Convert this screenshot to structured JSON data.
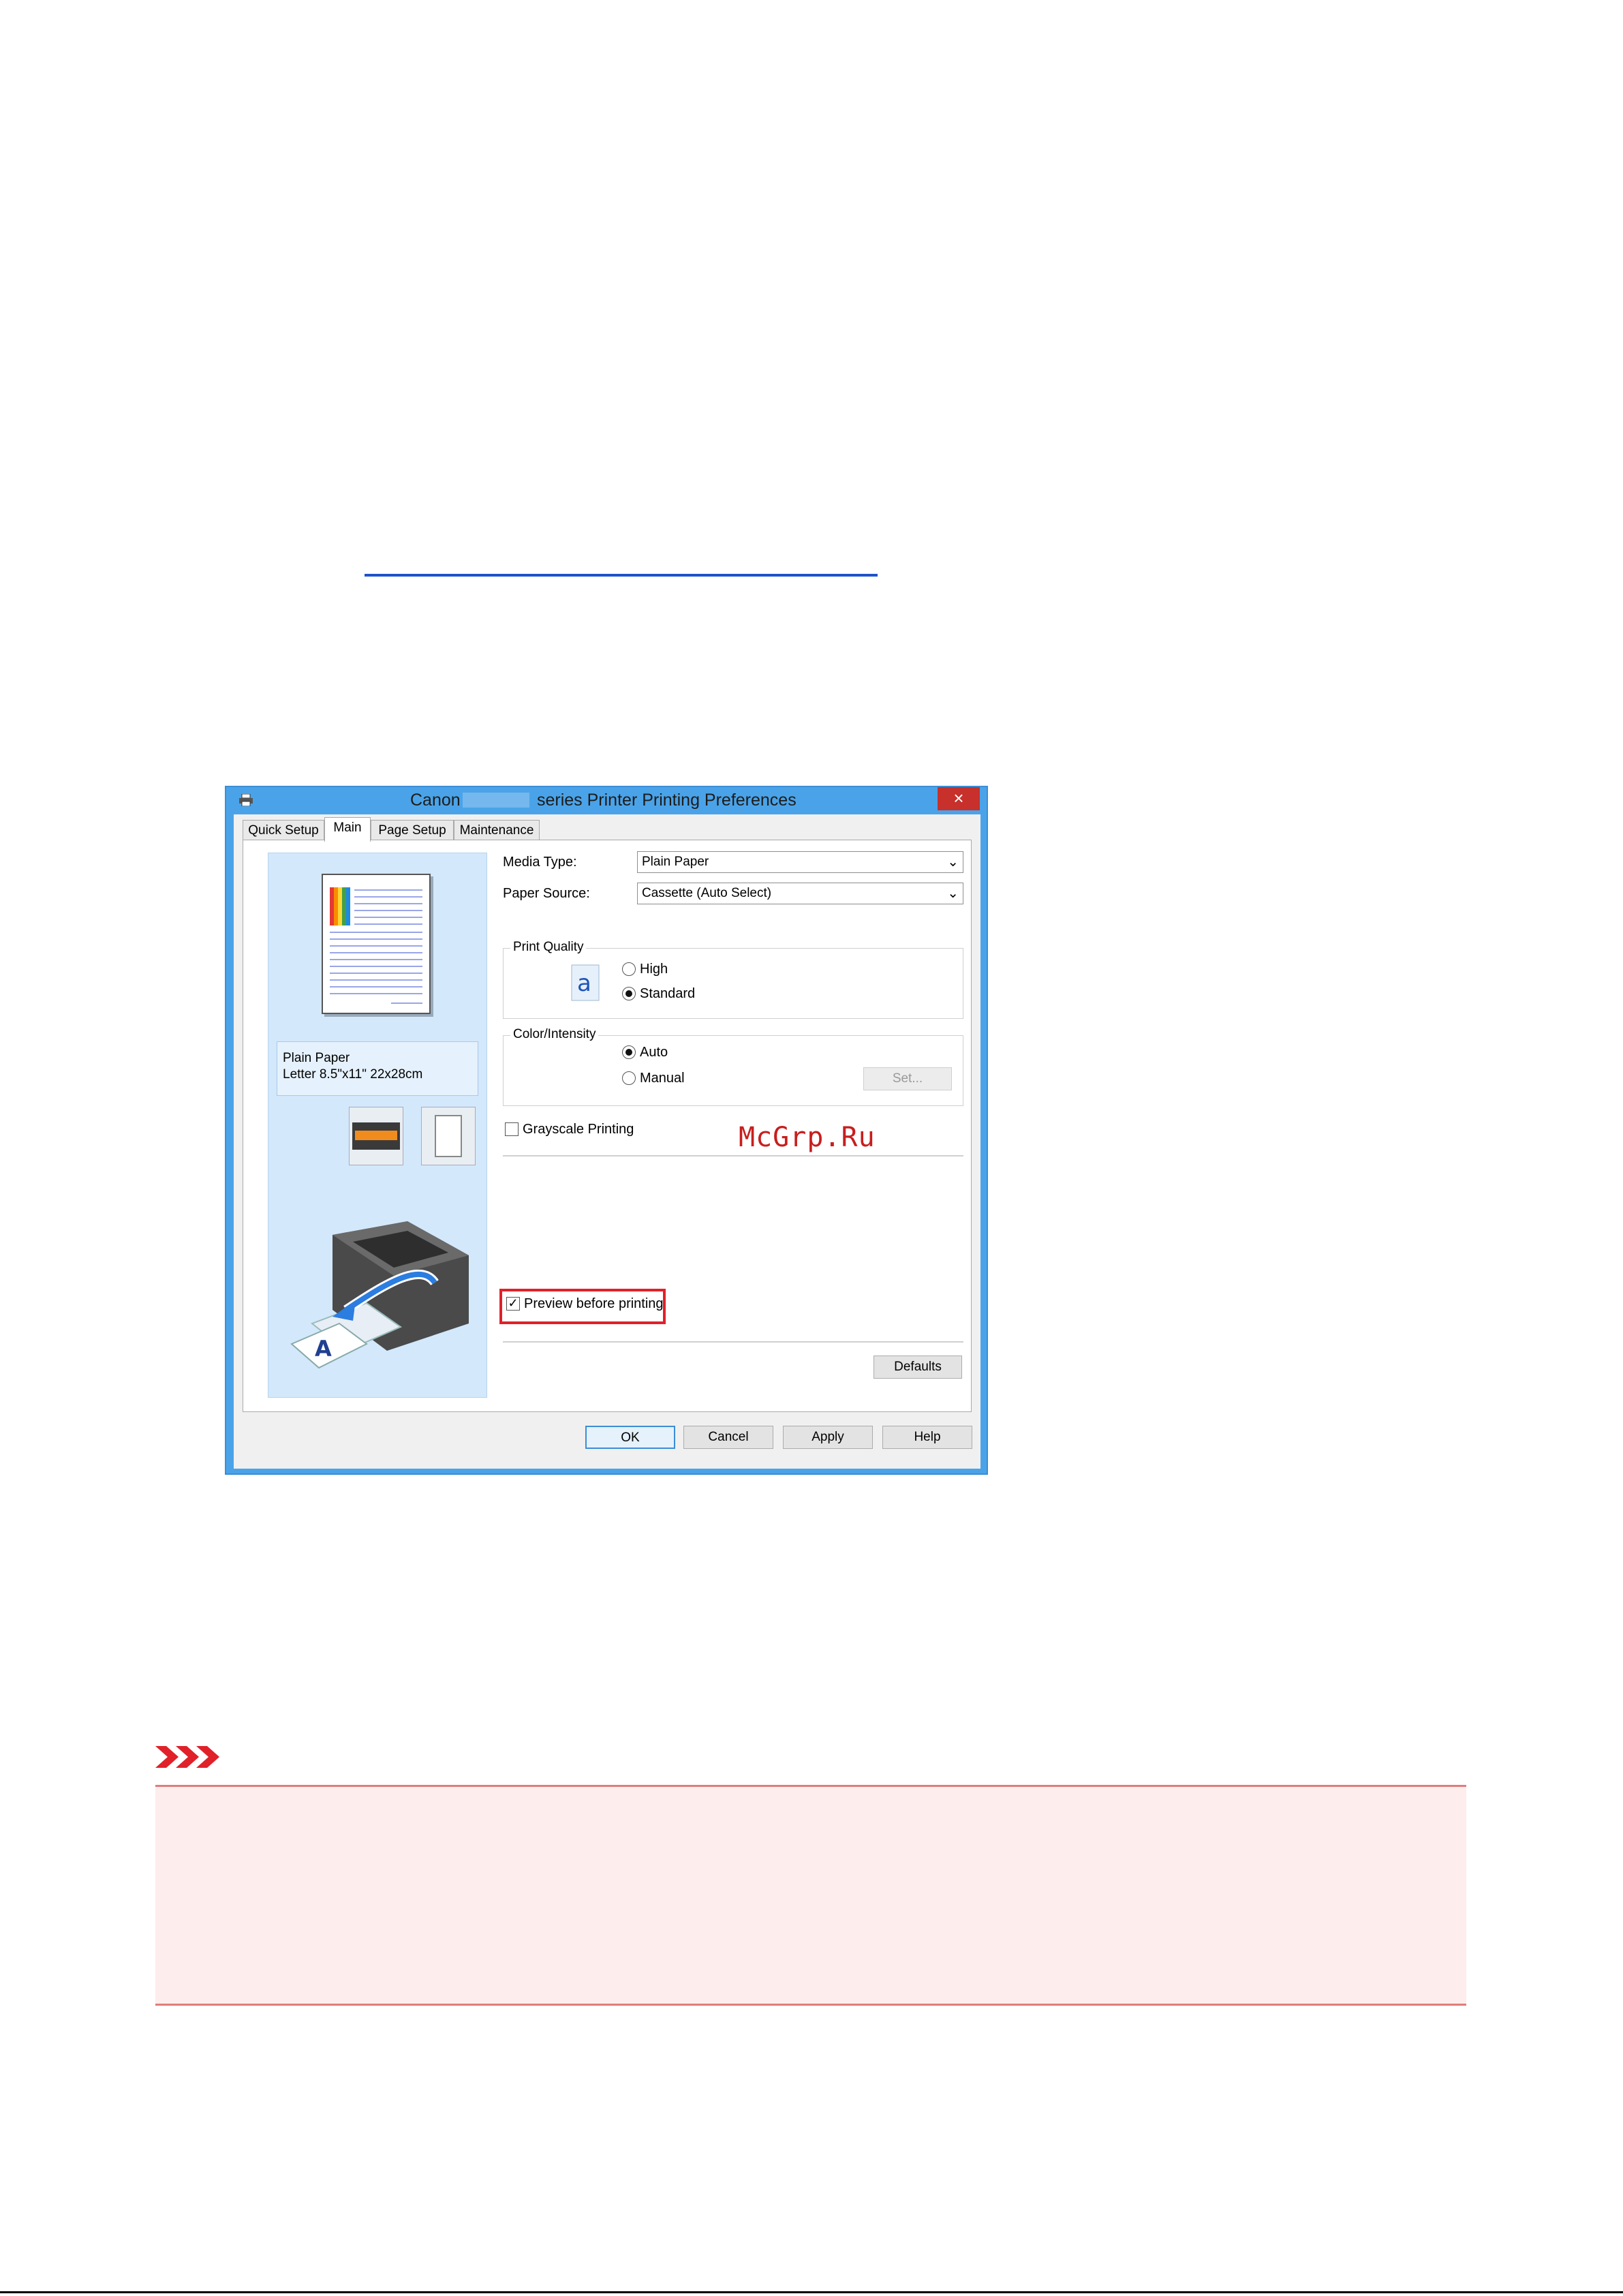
{
  "dialog": {
    "title_left": "Canon",
    "title_right": "series Printer Printing Preferences",
    "close_label": "×",
    "tabs": [
      "Quick Setup",
      "Main",
      "Page Setup",
      "Maintenance"
    ],
    "active_tab": "Main",
    "preview_info": {
      "line1": "Plain Paper",
      "line2": "Letter 8.5\"x11\" 22x28cm"
    },
    "media_type": {
      "label": "Media Type:",
      "value": "Plain Paper"
    },
    "paper_source": {
      "label": "Paper Source:",
      "value": "Cassette (Auto Select)"
    },
    "print_quality": {
      "title": "Print Quality",
      "icon_glyph": "a",
      "options": [
        "High",
        "Standard"
      ],
      "selected": "Standard"
    },
    "color_intensity": {
      "title": "Color/Intensity",
      "options": [
        "Auto",
        "Manual"
      ],
      "selected": "Auto",
      "set_button": "Set..."
    },
    "grayscale": {
      "label": "Grayscale Printing",
      "checked": false
    },
    "preview_before_printing": {
      "label": "Preview before printing",
      "checked": true
    },
    "defaults_button": "Defaults",
    "buttons": {
      "ok": "OK",
      "cancel": "Cancel",
      "apply": "Apply",
      "help": "Help"
    }
  },
  "watermark": "McGrp.Ru",
  "colors": {
    "highlight": "#e0212a",
    "link": "#1e53c8",
    "note_background": "#fdedec",
    "note_border": "#e07d7a",
    "dialog_frame": "#4aa3e8"
  }
}
